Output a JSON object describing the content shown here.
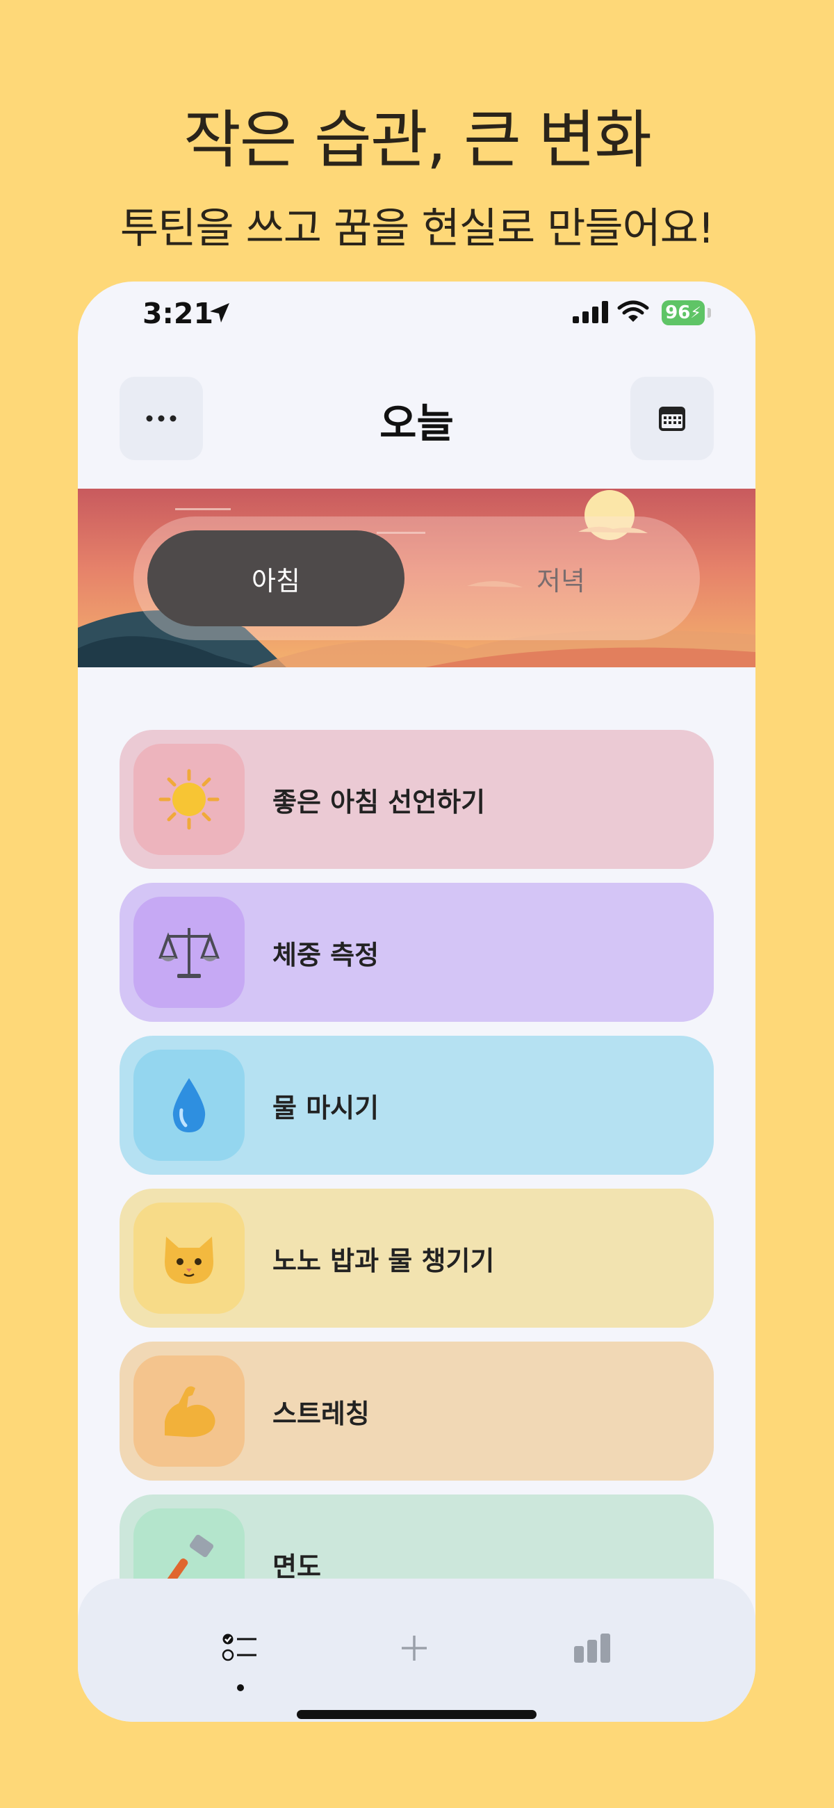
{
  "promo": {
    "headline": "작은 습관, 큰 변화",
    "subline": "투틴을 쓰고 꿈을 현실로 만들어요!"
  },
  "status_bar": {
    "time": "3:21",
    "battery": "96"
  },
  "header": {
    "title": "오늘",
    "menu_icon": "ellipsis-icon",
    "calendar_icon": "calendar-icon"
  },
  "segment": {
    "options": [
      "아침",
      "저녁"
    ],
    "selected": "아침"
  },
  "habits": [
    {
      "label": "좋은 아침 선언하기",
      "emoji": "☀️",
      "bg": "#EBCAD4",
      "icon_bg": "#EDB4BD"
    },
    {
      "label": "체중 측정",
      "emoji": "⚖️",
      "bg": "#D4C5F6",
      "icon_bg": "#C6A9F4"
    },
    {
      "label": "물 마시기",
      "emoji": "💧",
      "bg": "#B5E1F2",
      "icon_bg": "#94D6EF"
    },
    {
      "label": "노노 밥과 물 챙기기",
      "emoji": "🐱",
      "bg": "#F2E3B0",
      "icon_bg": "#F7DB88"
    },
    {
      "label": "스트레칭",
      "emoji": "💪",
      "bg": "#F1D8B5",
      "icon_bg": "#F4C48D"
    },
    {
      "label": "면도",
      "emoji": "🪒",
      "bg": "#CCE7DB",
      "icon_bg": "#B4E5CC"
    }
  ],
  "tab_bar": {
    "items": [
      "checklist-icon",
      "plus-icon",
      "bar-chart-icon"
    ],
    "active": "checklist-icon"
  }
}
